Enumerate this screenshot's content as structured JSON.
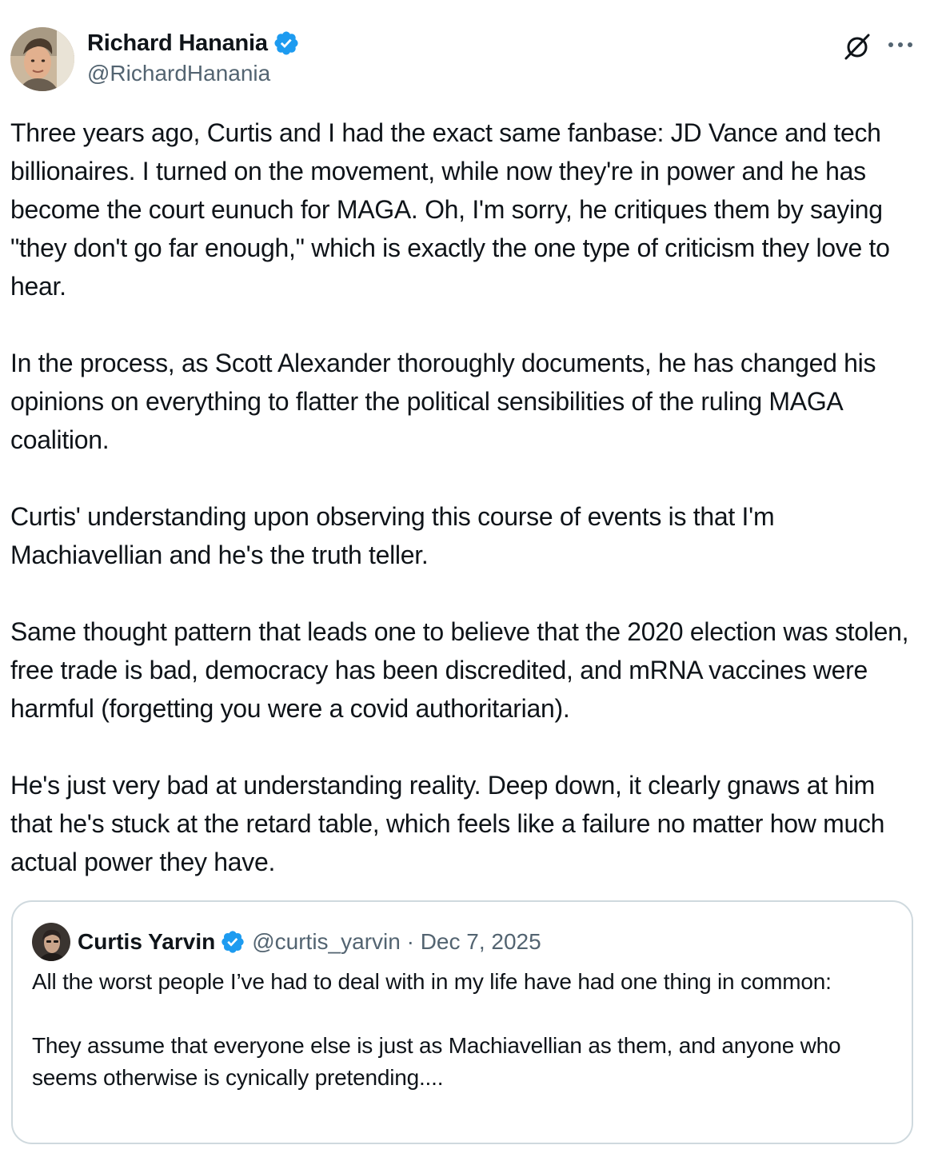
{
  "author": {
    "display_name": "Richard Hanania",
    "handle": "@RichardHanania",
    "avatar_icon": "profile-photo",
    "verified_icon": "verified-badge-icon"
  },
  "actions": {
    "grok_icon": "grok-icon",
    "more_icon": "more-options-icon"
  },
  "tweet": {
    "paragraphs": [
      "Three years ago, Curtis and I had the exact same fanbase: JD Vance and tech billionaires. I turned on the movement, while now they're in power and he has become the court eunuch for MAGA. Oh, I'm sorry, he critiques them by saying \"they don't go far enough,\" which is exactly the one type of criticism they love to hear.",
      "In the process, as Scott Alexander thoroughly documents, he has changed his opinions on everything to flatter the political sensibilities of the ruling MAGA coalition.",
      "Curtis' understanding upon observing this course of events is that I'm Machiavellian and he's the truth teller.",
      "Same thought pattern that leads one to believe that the 2020 election was stolen, free trade is bad, democracy has been discredited, and mRNA vaccines were harmful (forgetting you were a covid authoritarian).",
      "He's just very bad at understanding reality. Deep down, it clearly gnaws at him that he's stuck at the retard table, which feels like a failure no matter how much actual power they have."
    ]
  },
  "quote": {
    "display_name": "Curtis Yarvin",
    "meta": "@curtis_yarvin · Dec 7, 2025",
    "paragraphs": [
      "All the worst people I’ve had to deal with in my life have had one thing in common:",
      "They assume that everyone else is just as Machiavellian as them, and anyone who seems otherwise is cynically pretending...."
    ]
  },
  "colors": {
    "text": "#0f1419",
    "secondary": "#536471",
    "verified": "#1d9bf0",
    "border": "#cfd9de"
  }
}
